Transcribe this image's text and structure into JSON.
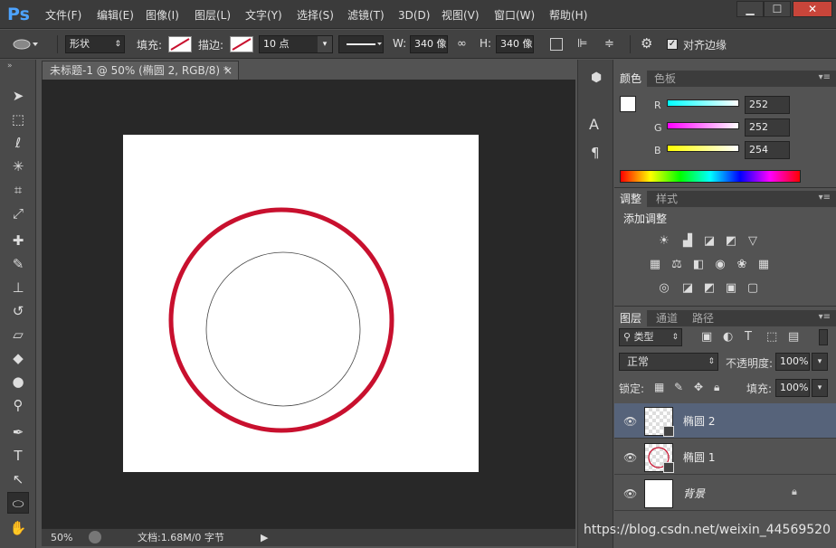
{
  "app": {
    "logo": "Ps"
  },
  "menu": [
    "文件(F)",
    "编辑(E)",
    "图像(I)",
    "图层(L)",
    "文字(Y)",
    "选择(S)",
    "滤镜(T)",
    "3D(D)",
    "视图(V)",
    "窗口(W)",
    "帮助(H)"
  ],
  "window_buttons": {
    "minimize": "▁",
    "maximize": "☐",
    "close": "✕"
  },
  "options": {
    "mode": "形状",
    "fill_label": "填充:",
    "stroke_label": "描边:",
    "stroke_width": "10 点",
    "w_label": "W:",
    "w_value": "340 像",
    "h_label": "H:",
    "h_value": "340 像",
    "align_edges": "对齐边缘"
  },
  "document": {
    "tab_title": "未标题-1 @ 50% (椭圆 2, RGB/8) *",
    "close": "×"
  },
  "status": {
    "zoom": "50%",
    "doc_info": "文档:1.68M/0 字节"
  },
  "color_panel": {
    "tabs": [
      "颜色",
      "色板"
    ],
    "channels": [
      {
        "label": "R",
        "value": "252"
      },
      {
        "label": "G",
        "value": "252"
      },
      {
        "label": "B",
        "value": "254"
      }
    ]
  },
  "adjust_panel": {
    "tabs": [
      "调整",
      "样式"
    ],
    "title": "添加调整"
  },
  "layers_panel": {
    "tabs": [
      "图层",
      "通道",
      "路径"
    ],
    "filter": "类型",
    "blend_mode": "正常",
    "opacity_label": "不透明度:",
    "opacity": "100%",
    "lock_label": "锁定:",
    "fill_label": "填充:",
    "fill": "100%",
    "layers": [
      {
        "name": "椭圆 2",
        "selected": true
      },
      {
        "name": "椭圆 1",
        "selected": false
      },
      {
        "name": "背景",
        "selected": false
      }
    ]
  },
  "watermark": "https://blog.csdn.net/weixin_44569520",
  "colors": {
    "accent_red": "#c8102e",
    "selected_layer": "#56637a"
  }
}
